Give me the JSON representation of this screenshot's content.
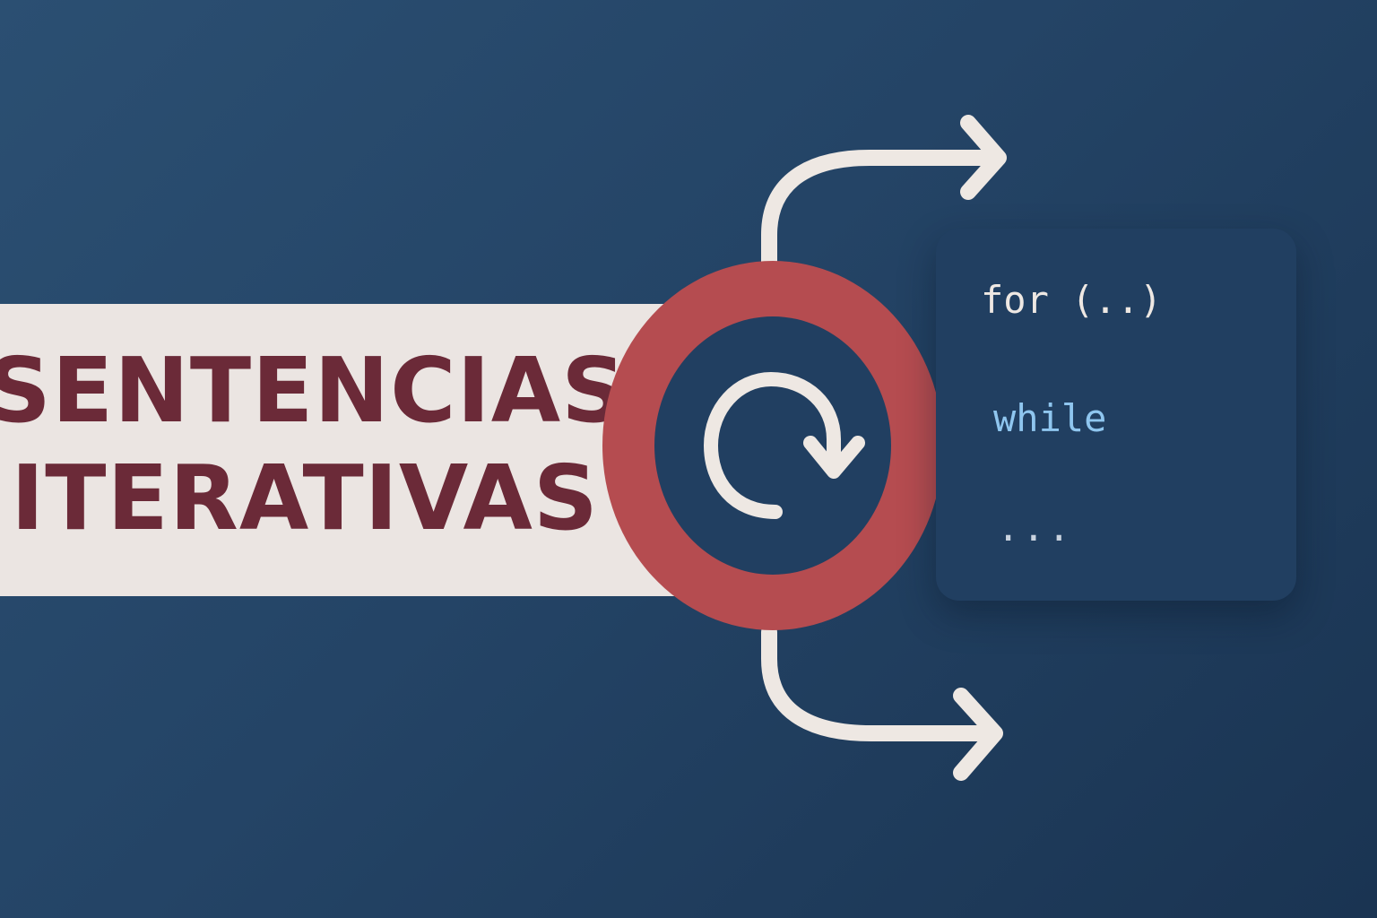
{
  "title": {
    "line1": "SENTENCIAS",
    "line2": "ITERATIVAS"
  },
  "code_card": {
    "line_for": "for (..)",
    "line_while": "while",
    "line_more": "..."
  },
  "icons": {
    "loop": "refresh-icon",
    "upper_arrow": "arrow-right-icon",
    "lower_arrow": "arrow-right-icon"
  },
  "colors": {
    "background": "#244466",
    "band": "#ebe5e2",
    "title_text": "#6b2a38",
    "ring": "#b54c50",
    "card": "#213f61",
    "code_primary": "#eee8e3",
    "code_keyword": "#8fc6ef"
  }
}
